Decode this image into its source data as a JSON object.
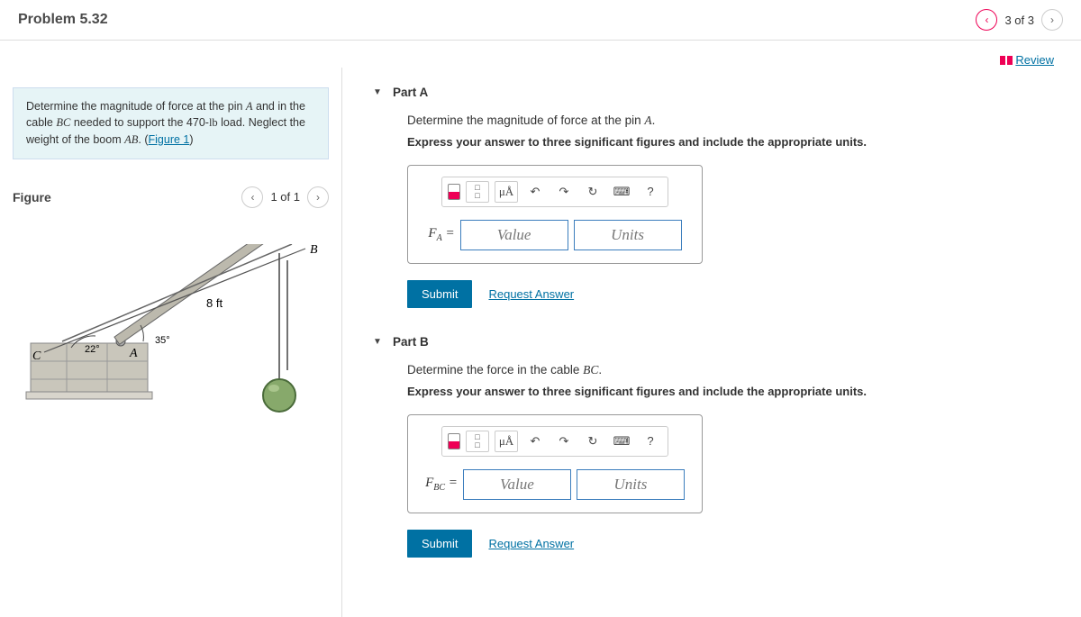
{
  "header": {
    "title": "Problem 5.32",
    "pager_text": "3 of 3"
  },
  "review_label": "Review",
  "description": {
    "text_before_A": "Determine the magnitude of force at the pin ",
    "A": "A",
    "text_mid1": " and in the cable ",
    "BC": "BC",
    "text_mid2": " needed to support the 470-",
    "lb": "lb",
    "text_mid3": " load. Neglect the weight of the boom ",
    "AB": "AB",
    "text_end": ". (",
    "figure_link": "Figure 1",
    "close": ")"
  },
  "figure": {
    "heading": "Figure",
    "pager": "1 of 1",
    "label_8ft": "8 ft",
    "label_22": "22°",
    "label_35": "35°",
    "point_A": "A",
    "point_B": "B",
    "point_C": "C"
  },
  "parts": {
    "A": {
      "title": "Part A",
      "question_pre": "Determine the magnitude of force at the pin ",
      "question_sym": "A",
      "question_post": ".",
      "instruction": "Express your answer to three significant figures and include the appropriate units.",
      "label_html": "F_A =",
      "value_placeholder": "Value",
      "units_placeholder": "Units",
      "submit": "Submit",
      "request": "Request Answer",
      "mu": "μÅ",
      "help": "?"
    },
    "B": {
      "title": "Part B",
      "question_pre": "Determine the force in the cable ",
      "question_sym": "BC",
      "question_post": ".",
      "instruction": "Express your answer to three significant figures and include the appropriate units.",
      "label_html": "F_BC =",
      "value_placeholder": "Value",
      "units_placeholder": "Units",
      "submit": "Submit",
      "request": "Request Answer",
      "mu": "μÅ",
      "help": "?"
    }
  }
}
